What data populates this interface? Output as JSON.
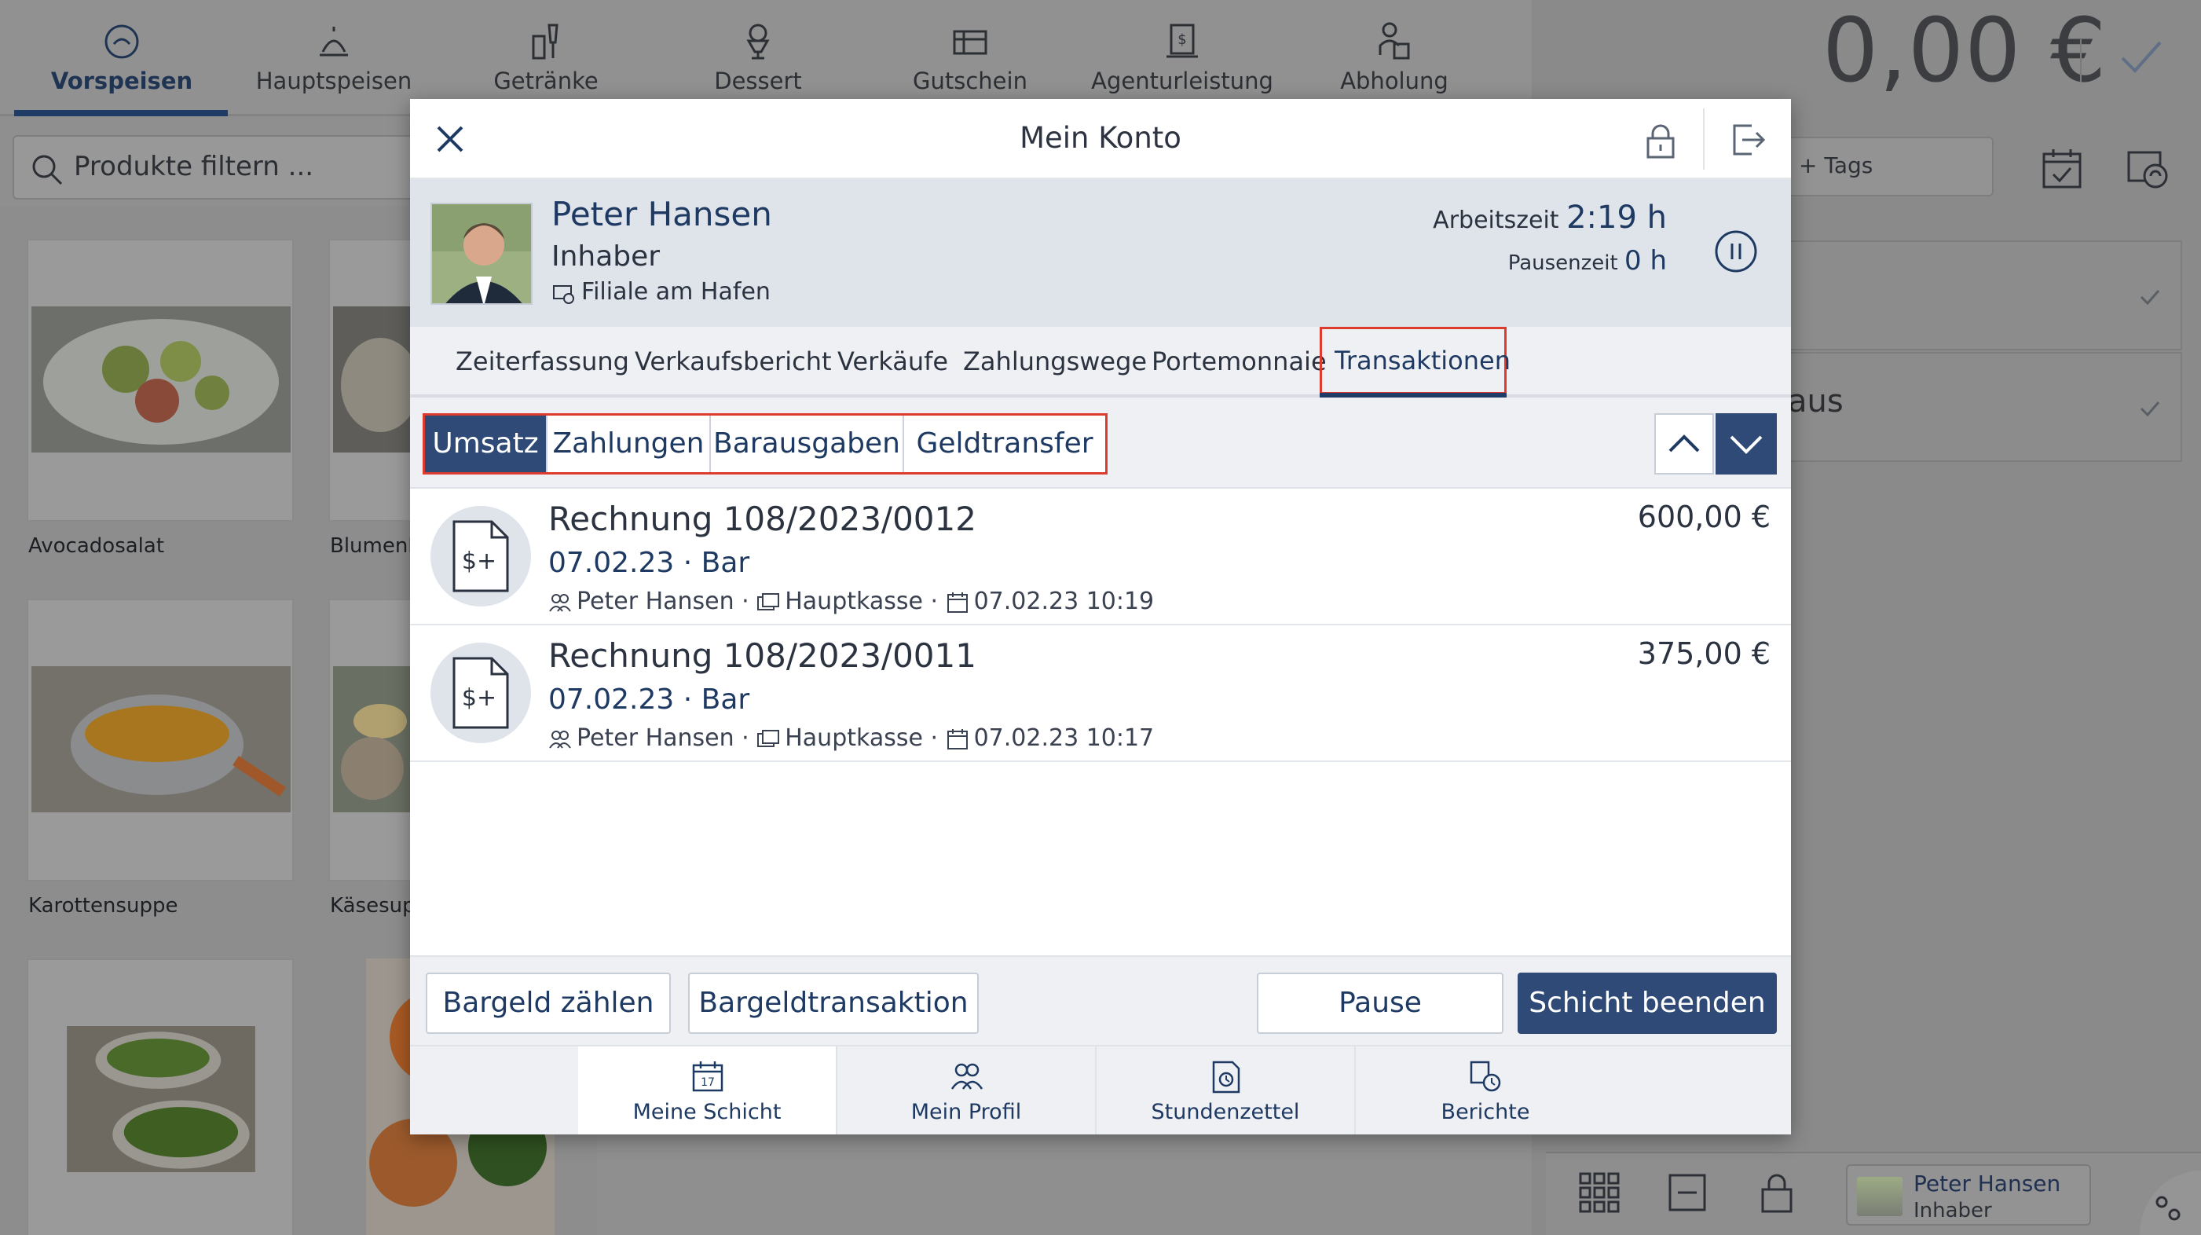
{
  "categories": [
    {
      "label": "Vorspeisen",
      "icon": "starter-icon",
      "active": true
    },
    {
      "label": "Hauptspeisen",
      "icon": "main-dish-icon"
    },
    {
      "label": "Getränke",
      "icon": "drinks-icon"
    },
    {
      "label": "Dessert",
      "icon": "dessert-icon"
    },
    {
      "label": "Gutschein",
      "icon": "voucher-icon"
    },
    {
      "label": "Agenturleistung",
      "icon": "agency-service-icon"
    },
    {
      "label": "Abholung",
      "icon": "pickup-icon"
    }
  ],
  "filter": {
    "placeholder": "Produkte filtern ..."
  },
  "products": [
    {
      "name": "Avocadosalat"
    },
    {
      "name": "Blumenk"
    },
    {
      "name": "Karottensuppe"
    },
    {
      "name": "Käsesupp"
    }
  ],
  "order": {
    "total": "0,00 €",
    "tags_label": "+ Tags",
    "visible_item_fragment": "aus"
  },
  "footer_user": {
    "name": "Peter Hansen",
    "role": "Inhaber"
  },
  "modal": {
    "title": "Mein Konto",
    "user": {
      "name": "Peter Hansen",
      "role": "Inhaber",
      "branch": "Filiale am Hafen",
      "worktime_label": "Arbeitszeit",
      "worktime_value": "2:19 h",
      "pausetime_label": "Pausenzeit",
      "pausetime_value": "0 h"
    },
    "tabs": [
      {
        "label": "Zeiterfassung"
      },
      {
        "label": "Verkaufsbericht"
      },
      {
        "label": "Verkäufe"
      },
      {
        "label": "Zahlungswege"
      },
      {
        "label": "Portemonnaie"
      },
      {
        "label": "Transaktionen",
        "active": true
      }
    ],
    "segments": [
      {
        "label": "Umsatz",
        "active": true
      },
      {
        "label": "Zahlungen"
      },
      {
        "label": "Barausgaben"
      },
      {
        "label": "Geldtransfer"
      }
    ],
    "transactions": [
      {
        "title": "Rechnung 108/2023/0012",
        "subtitle": "07.02.23 · Bar",
        "employee": "Peter Hansen",
        "register": "Hauptkasse",
        "datetime": "07.02.23 10:19",
        "amount": "600,00 €"
      },
      {
        "title": "Rechnung 108/2023/0011",
        "subtitle": "07.02.23 · Bar",
        "employee": "Peter Hansen",
        "register": "Hauptkasse",
        "datetime": "07.02.23 10:17",
        "amount": "375,00 €"
      }
    ],
    "actions": {
      "count_cash": "Bargeld zählen",
      "cash_transaction": "Bargeldtransaktion",
      "pause": "Pause",
      "end_shift": "Schicht beenden"
    },
    "bottom_nav": [
      {
        "label": "Meine Schicht",
        "icon": "calendar-icon",
        "active": true
      },
      {
        "label": "Mein Profil",
        "icon": "profile-icon"
      },
      {
        "label": "Stundenzettel",
        "icon": "timesheet-icon"
      },
      {
        "label": "Berichte",
        "icon": "reports-icon"
      }
    ]
  },
  "colors": {
    "primary": "#2f4a76",
    "highlight_border": "#dc3b2d",
    "overlay_gray": "#8f8f8f"
  }
}
